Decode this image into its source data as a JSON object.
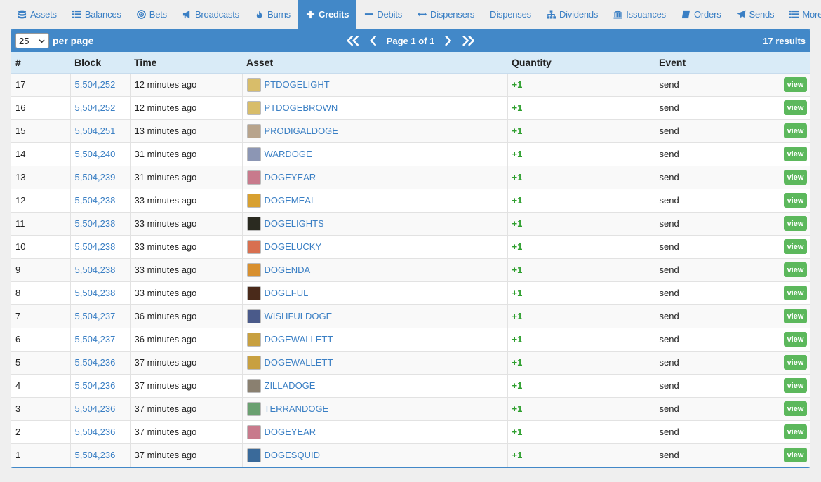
{
  "nav": [
    {
      "label": "Assets",
      "icon": "database-icon"
    },
    {
      "label": "Balances",
      "icon": "list-icon"
    },
    {
      "label": "Bets",
      "icon": "target-icon"
    },
    {
      "label": "Broadcasts",
      "icon": "bullhorn-icon"
    },
    {
      "label": "Burns",
      "icon": "fire-icon"
    },
    {
      "label": "Credits",
      "icon": "plus-icon",
      "active": true
    },
    {
      "label": "Debits",
      "icon": "minus-icon"
    },
    {
      "label": "Dispensers",
      "icon": "arrows-horizontal-icon"
    },
    {
      "label": "Dispenses",
      "icon": ""
    },
    {
      "label": "Dividends",
      "icon": "sitemap-icon"
    },
    {
      "label": "Issuances",
      "icon": "bank-icon"
    },
    {
      "label": "Orders",
      "icon": "book-icon"
    },
    {
      "label": "Sends",
      "icon": "paper-plane-icon"
    },
    {
      "label": "More",
      "icon": "list-icon",
      "dropdown": true
    }
  ],
  "toolbar": {
    "per_page_value": "25",
    "per_page_label": "per page",
    "page_label": "Page 1 of 1",
    "results": "17 results"
  },
  "table": {
    "columns": [
      "#",
      "Block",
      "Time",
      "Asset",
      "Quantity",
      "Event"
    ],
    "view_label": "view",
    "rows": [
      {
        "n": "17",
        "block": "5,504,252",
        "time": "12 minutes ago",
        "asset": "PTDOGELIGHT",
        "qty": "+1",
        "event": "send",
        "thumb": "#d8bd6a"
      },
      {
        "n": "16",
        "block": "5,504,252",
        "time": "12 minutes ago",
        "asset": "PTDOGEBROWN",
        "qty": "+1",
        "event": "send",
        "thumb": "#d8bd6a"
      },
      {
        "n": "15",
        "block": "5,504,251",
        "time": "13 minutes ago",
        "asset": "PRODIGALDOGE",
        "qty": "+1",
        "event": "send",
        "thumb": "#b8a48c"
      },
      {
        "n": "14",
        "block": "5,504,240",
        "time": "31 minutes ago",
        "asset": "WARDOGE",
        "qty": "+1",
        "event": "send",
        "thumb": "#8c96b4"
      },
      {
        "n": "13",
        "block": "5,504,239",
        "time": "31 minutes ago",
        "asset": "DOGEYEAR",
        "qty": "+1",
        "event": "send",
        "thumb": "#c87a8c"
      },
      {
        "n": "12",
        "block": "5,504,238",
        "time": "33 minutes ago",
        "asset": "DOGEMEAL",
        "qty": "+1",
        "event": "send",
        "thumb": "#d8a030"
      },
      {
        "n": "11",
        "block": "5,504,238",
        "time": "33 minutes ago",
        "asset": "DOGELIGHTS",
        "qty": "+1",
        "event": "send",
        "thumb": "#2a2a20"
      },
      {
        "n": "10",
        "block": "5,504,238",
        "time": "33 minutes ago",
        "asset": "DOGELUCKY",
        "qty": "+1",
        "event": "send",
        "thumb": "#d87050"
      },
      {
        "n": "9",
        "block": "5,504,238",
        "time": "33 minutes ago",
        "asset": "DOGENDA",
        "qty": "+1",
        "event": "send",
        "thumb": "#d89030"
      },
      {
        "n": "8",
        "block": "5,504,238",
        "time": "33 minutes ago",
        "asset": "DOGEFUL",
        "qty": "+1",
        "event": "send",
        "thumb": "#4a2a1a"
      },
      {
        "n": "7",
        "block": "5,504,237",
        "time": "36 minutes ago",
        "asset": "WISHFULDOGE",
        "qty": "+1",
        "event": "send",
        "thumb": "#4a5a8a"
      },
      {
        "n": "6",
        "block": "5,504,237",
        "time": "36 minutes ago",
        "asset": "DOGEWALLETT",
        "qty": "+1",
        "event": "send",
        "thumb": "#c8a040"
      },
      {
        "n": "5",
        "block": "5,504,236",
        "time": "37 minutes ago",
        "asset": "DOGEWALLETT",
        "qty": "+1",
        "event": "send",
        "thumb": "#c8a040"
      },
      {
        "n": "4",
        "block": "5,504,236",
        "time": "37 minutes ago",
        "asset": "ZILLADOGE",
        "qty": "+1",
        "event": "send",
        "thumb": "#8a8070"
      },
      {
        "n": "3",
        "block": "5,504,236",
        "time": "37 minutes ago",
        "asset": "TERRANDOGE",
        "qty": "+1",
        "event": "send",
        "thumb": "#6aa070"
      },
      {
        "n": "2",
        "block": "5,504,236",
        "time": "37 minutes ago",
        "asset": "DOGEYEAR",
        "qty": "+1",
        "event": "send",
        "thumb": "#c87a8c"
      },
      {
        "n": "1",
        "block": "5,504,236",
        "time": "37 minutes ago",
        "asset": "DOGESQUID",
        "qty": "+1",
        "event": "send",
        "thumb": "#3a6a9a"
      }
    ]
  },
  "colors": {
    "accent": "#4288c8",
    "link": "#3a7fc4",
    "header_row": "#d9ebf7",
    "positive": "#2e9f2e",
    "view_button": "#5cb85c"
  }
}
